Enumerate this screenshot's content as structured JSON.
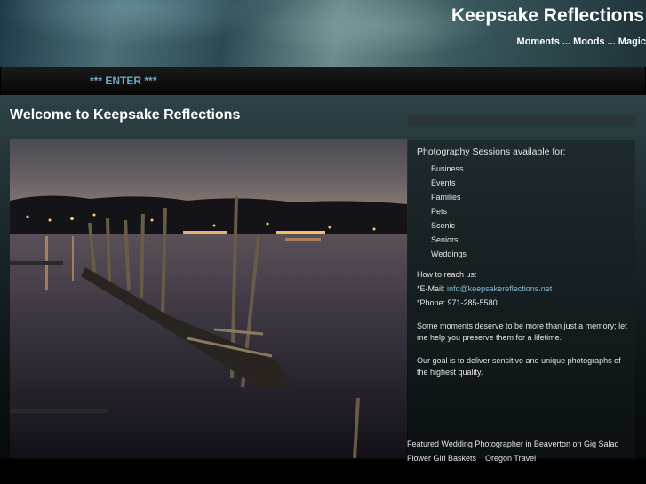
{
  "header": {
    "site_title": "Keepsake Reflections",
    "tagline": "Moments ... Moods ... Magic"
  },
  "nav": {
    "enter_label": "*** ENTER ***"
  },
  "main": {
    "page_title": "Welcome to Keepsake Reflections",
    "photo_alt": ""
  },
  "sidebar": {
    "sessions_heading": "Photography Sessions available for:",
    "sessions": [
      "Business",
      "Events",
      "Families",
      "Pets",
      "Scenic",
      "Seniors",
      "Weddings"
    ],
    "reach_heading": "How to reach us:",
    "email_prefix": "*E-Mail: ",
    "email": "info@keepsakereflections.net",
    "phone": "*Phone: 971-285-5580",
    "para1": "Some moments deserve to be more than just a memory; let me help you preserve them for a lifetime.",
    "para2": "Our goal is to deliver sensitive and unique photographs of the highest quality."
  },
  "footer": {
    "link1": "Featured Wedding Photographer in Beaverton on Gig Salad",
    "link2": "Flower Girl Baskets",
    "link3": "Oregon Travel"
  },
  "colors": {
    "link": "#8ab8d0",
    "nav_link": "#6fa6c4",
    "background": "#000000"
  }
}
